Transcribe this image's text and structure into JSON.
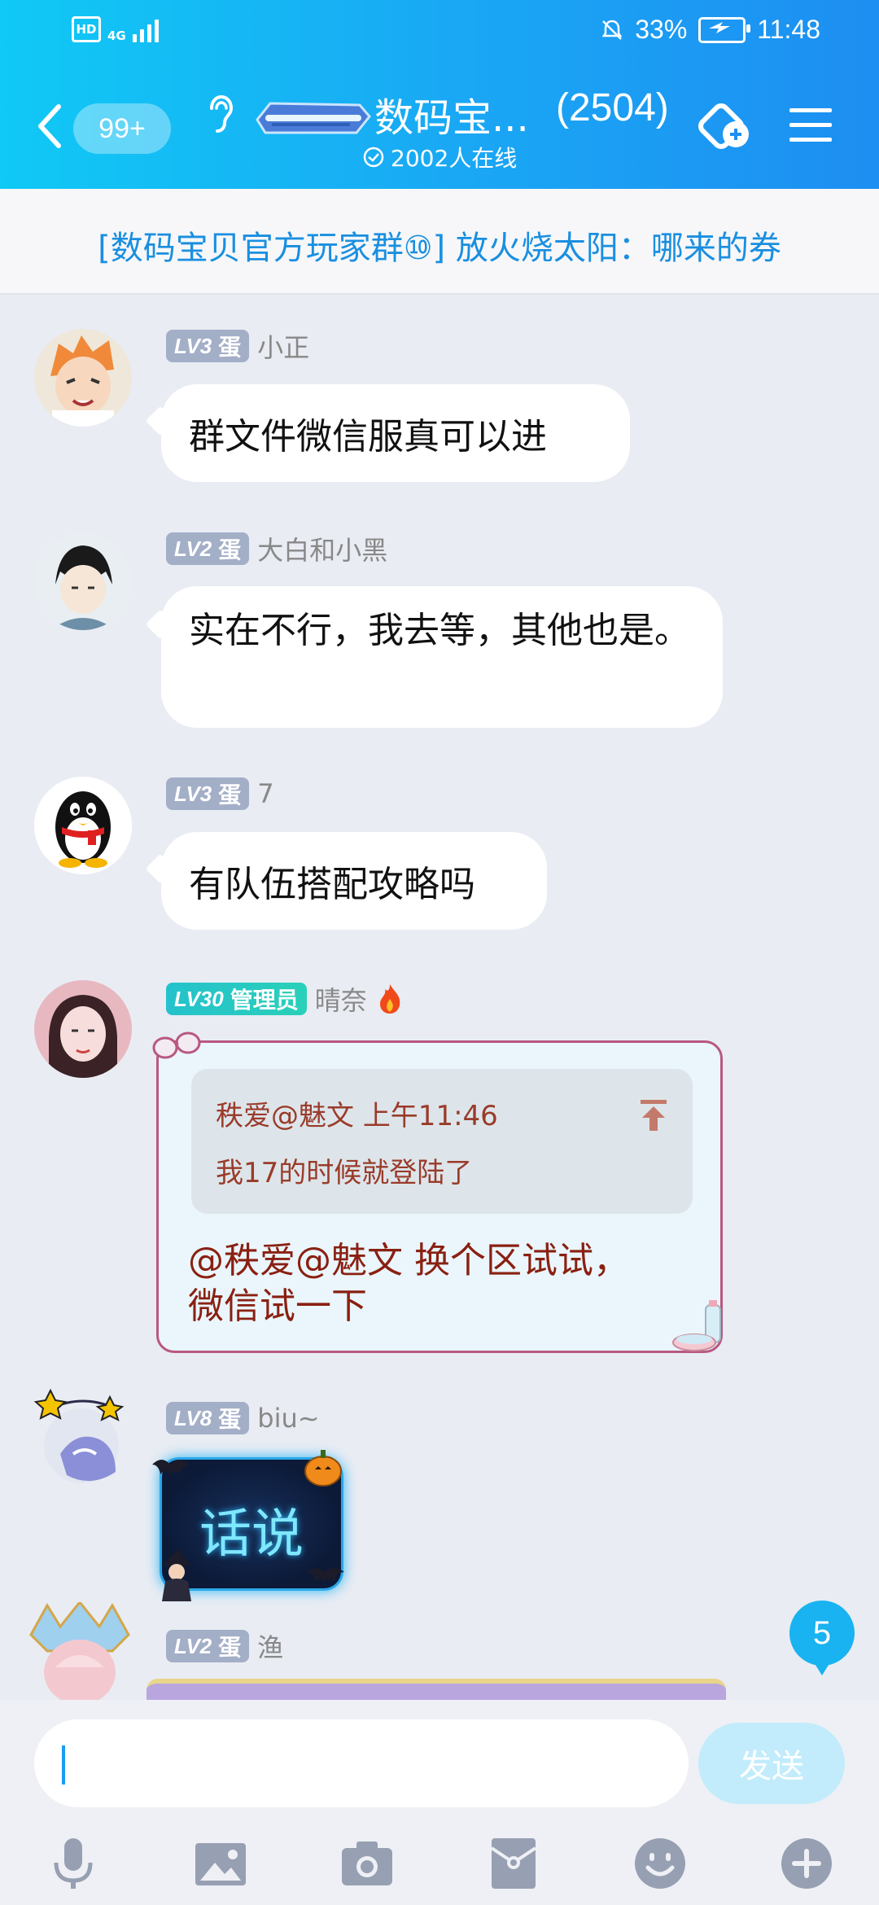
{
  "status_bar": {
    "hd": "HD",
    "network": "4G",
    "battery_percent": "33%",
    "time": "11:48"
  },
  "header": {
    "unread_count": "99+",
    "group_name": "数码宝...",
    "member_count": "(2504)",
    "online_text": "2002人在线"
  },
  "notice": {
    "text": "[数码宝贝官方玩家群⑩] 放火烧太阳：哪来的券"
  },
  "messages": [
    {
      "level": "LV3",
      "title": "蛋",
      "sender": "小正",
      "text": "群文件微信服真可以进"
    },
    {
      "level": "LV2",
      "title": "蛋",
      "sender": "大白和小黑",
      "text": "实在不行，我去等，其他也是。"
    },
    {
      "level": "LV3",
      "title": "蛋",
      "sender": "7",
      "text": "有队伍搭配攻略吗"
    },
    {
      "level": "LV30",
      "title": "管理员",
      "sender": "晴奈",
      "quote": {
        "author": "秩爱@魅文",
        "time": "上午11:46",
        "text": "我17的时候就登陆了"
      },
      "text_line1": "@秩爱@魅文 换个区试试，",
      "text_line2": "微信试一下"
    },
    {
      "level": "LV8",
      "title": "蛋",
      "sender": "biu~",
      "text": "话说"
    },
    {
      "level": "LV2",
      "title": "蛋",
      "sender": "渔"
    }
  ],
  "new_messages_count": "5",
  "composer": {
    "input_value": "",
    "send_label": "发送"
  },
  "colors": {
    "header_gradient_start": "#10c9f5",
    "header_gradient_end": "#1d8ef2",
    "notice_text": "#1a8fe0",
    "admin_badge": "#24c2cc",
    "send_disabled": "#c2ecfb"
  },
  "icons": [
    "back-icon",
    "ear-icon",
    "call-icon",
    "menu-icon",
    "mic-icon",
    "image-icon",
    "camera-icon",
    "red-packet-icon",
    "emoji-icon",
    "plus-icon"
  ]
}
